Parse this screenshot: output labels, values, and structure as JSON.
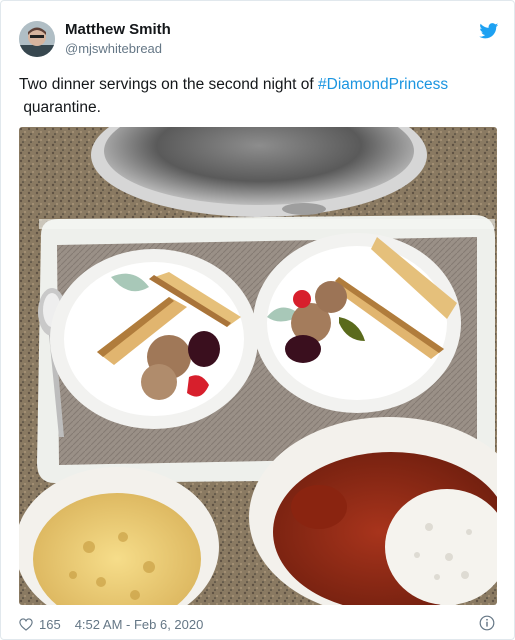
{
  "tweet": {
    "author_name": "Matthew Smith",
    "author_handle": "@mjswhitebread",
    "text_before": "Two dinner servings on the second night of ",
    "hashtag": "#DiamondPrincess",
    "text_after": "quarantine.",
    "like_count": "165",
    "timestamp": "4:52 AM - Feb 6, 2020"
  },
  "icons": {
    "brand": "twitter-bird-icon",
    "like": "heart-outline-icon",
    "info": "info-icon"
  },
  "colors": {
    "twitter_blue": "#1da1f2",
    "hashtag_blue": "#1b95e0",
    "secondary_text": "#657786"
  }
}
